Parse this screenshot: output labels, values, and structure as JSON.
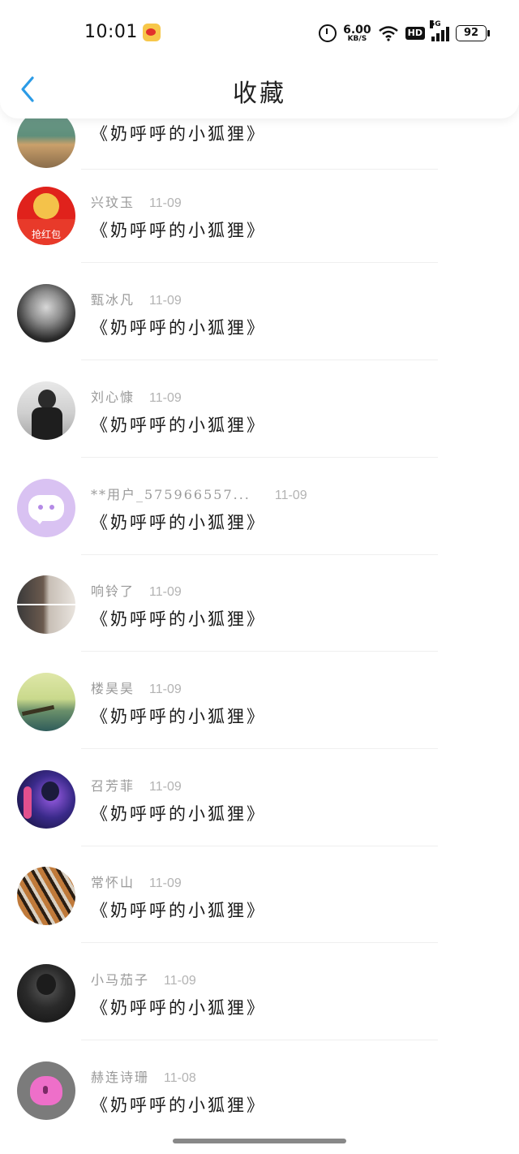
{
  "status": {
    "time": "10:01",
    "net_speed": "6.00",
    "net_unit": "KB/S",
    "hd": "HD",
    "signal": "5G",
    "battery": "92"
  },
  "header": {
    "title": "收藏"
  },
  "items": [
    {
      "name": "",
      "date": "",
      "title": "《奶呼呼的小狐狸》",
      "avatar": "lake-scene"
    },
    {
      "name": "兴玟玉",
      "date": "11-09",
      "title": "《奶呼呼的小狐狸》",
      "avatar": "red-envelope",
      "avatar_text": "抢红包"
    },
    {
      "name": "甄冰凡",
      "date": "11-09",
      "title": "《奶呼呼的小狐狸》",
      "avatar": "face-bw"
    },
    {
      "name": "刘心慷",
      "date": "11-09",
      "title": "《奶呼呼的小狐狸》",
      "avatar": "person-bw"
    },
    {
      "name": "**用户_575966557...",
      "date": "11-09",
      "title": "《奶呼呼的小狐狸》",
      "avatar": "chat-bubble"
    },
    {
      "name": "响铃了",
      "date": "11-09",
      "title": "《奶呼呼的小狐狸》",
      "avatar": "mirror-selfie"
    },
    {
      "name": "楼昊昊",
      "date": "11-09",
      "title": "《奶呼呼的小狐狸》",
      "avatar": "pier-sunset"
    },
    {
      "name": "召芳菲",
      "date": "11-09",
      "title": "《奶呼呼的小狐狸》",
      "avatar": "neon-girl"
    },
    {
      "name": "常怀山",
      "date": "11-09",
      "title": "《奶呼呼的小狐狸》",
      "avatar": "tigers"
    },
    {
      "name": "小马茄子",
      "date": "11-09",
      "title": "《奶呼呼的小狐狸》",
      "avatar": "dark-portrait"
    },
    {
      "name": "赫连诗珊",
      "date": "11-08",
      "title": "《奶呼呼的小狐狸》",
      "avatar": "pink-heart-lock"
    }
  ],
  "colors": {
    "accent": "#2b9be6",
    "name": "#9a9a9a",
    "date": "#b3b3b3"
  }
}
